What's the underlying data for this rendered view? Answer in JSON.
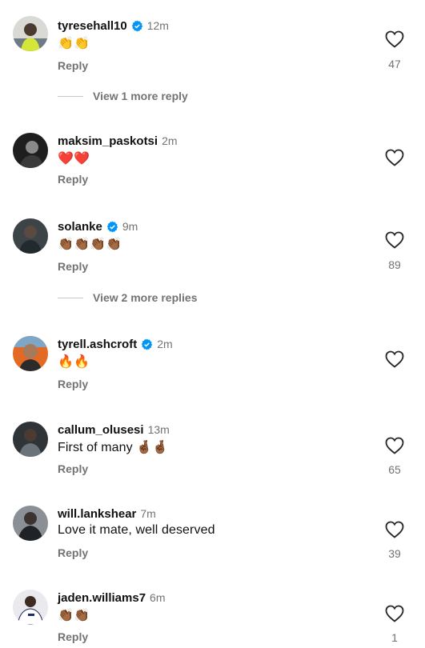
{
  "comments": [
    {
      "username": "tyresehall10",
      "verified": true,
      "time": "12m",
      "text": "👏👏",
      "reply_label": "Reply",
      "likes": "47",
      "view_replies": "View 1 more reply",
      "avatar": "avatar-photo"
    },
    {
      "username": "maksim_paskotsi",
      "verified": false,
      "time": "2m",
      "text": "❤️❤️",
      "reply_label": "Reply",
      "likes": "",
      "avatar": "avatar-photo"
    },
    {
      "username": "solanke",
      "verified": true,
      "time": "9m",
      "text": "👏🏾👏🏾👏🏾👏🏾",
      "reply_label": "Reply",
      "likes": "89",
      "view_replies": "View 2 more replies",
      "avatar": "avatar-photo"
    },
    {
      "username": "tyrell.ashcroft",
      "verified": true,
      "time": "2m",
      "text": "🔥🔥",
      "reply_label": "Reply",
      "likes": "",
      "avatar": "avatar-photo"
    },
    {
      "username": "callum_olusesi",
      "verified": false,
      "time": "13m",
      "text": "First of many 🤞🏾🤞🏾",
      "reply_label": "Reply",
      "likes": "65",
      "avatar": "avatar-photo"
    },
    {
      "username": "will.lankshear",
      "verified": false,
      "time": "7m",
      "text": "Love it mate, well deserved",
      "reply_label": "Reply",
      "likes": "39",
      "avatar": "avatar-photo"
    },
    {
      "username": "jaden.williams7",
      "verified": false,
      "time": "6m",
      "text": "👏🏾👏🏾",
      "reply_label": "Reply",
      "likes": "1",
      "avatar": "avatar-photo"
    }
  ],
  "icons": {
    "like": "heart-icon",
    "verified": "verified-badge-icon"
  },
  "colors": {
    "verified_blue": "#0095f6",
    "secondary_text": "#737373"
  }
}
